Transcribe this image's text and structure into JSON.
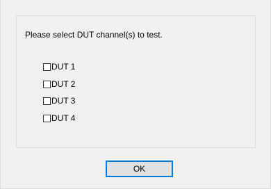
{
  "dialog": {
    "prompt": "Please select DUT channel(s) to test.",
    "checkboxes": [
      {
        "label": "DUT 1",
        "checked": false
      },
      {
        "label": "DUT 2",
        "checked": false
      },
      {
        "label": "DUT 3",
        "checked": false
      },
      {
        "label": "DUT 4",
        "checked": false
      }
    ],
    "ok_label": "OK"
  }
}
